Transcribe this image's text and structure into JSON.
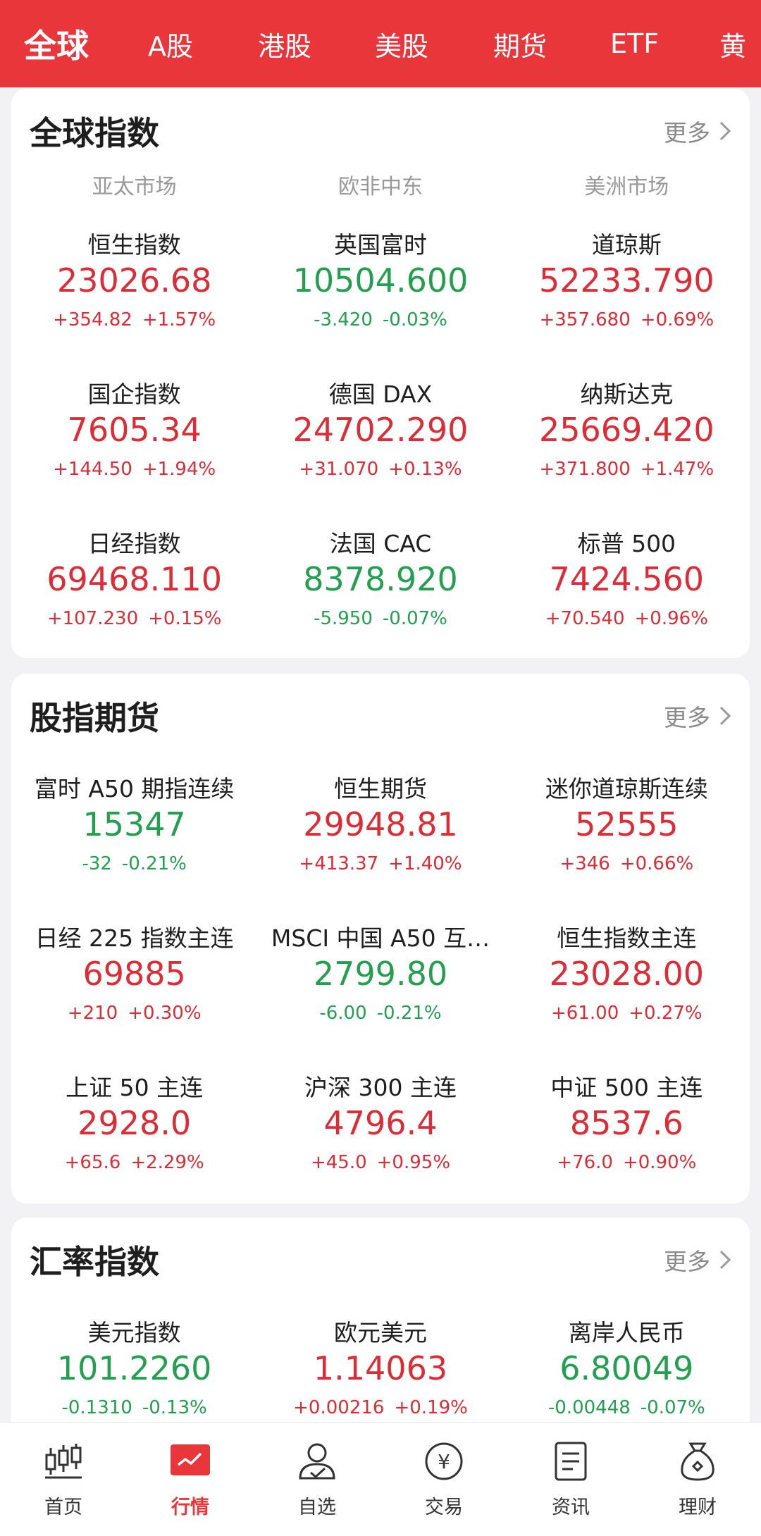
{
  "top_tabs": [
    {
      "label": "全球",
      "active": true
    },
    {
      "label": "A股"
    },
    {
      "label": "港股"
    },
    {
      "label": "美股"
    },
    {
      "label": "期货"
    },
    {
      "label": "ETF"
    },
    {
      "label": "黄"
    }
  ],
  "theme": {
    "brand_red": "#e8363b",
    "up_color": "#dd2c36",
    "down_color": "#22a04f"
  },
  "global_indices": {
    "title": "全球指数",
    "more_label": "更多",
    "regions": [
      "亚太市场",
      "欧非中东",
      "美洲市场"
    ],
    "items": [
      {
        "name": "恒生指数",
        "price": "23026.68",
        "change": "+354.82",
        "pct": "+1.57%",
        "dir": "up"
      },
      {
        "name": "英国富时",
        "price": "10504.600",
        "change": "-3.420",
        "pct": "-0.03%",
        "dir": "down"
      },
      {
        "name": "道琼斯",
        "price": "52233.790",
        "change": "+357.680",
        "pct": "+0.69%",
        "dir": "up"
      },
      {
        "name": "国企指数",
        "price": "7605.34",
        "change": "+144.50",
        "pct": "+1.94%",
        "dir": "up"
      },
      {
        "name": "德国 DAX",
        "price": "24702.290",
        "change": "+31.070",
        "pct": "+0.13%",
        "dir": "up"
      },
      {
        "name": "纳斯达克",
        "price": "25669.420",
        "change": "+371.800",
        "pct": "+1.47%",
        "dir": "up"
      },
      {
        "name": "日经指数",
        "price": "69468.110",
        "change": "+107.230",
        "pct": "+0.15%",
        "dir": "up"
      },
      {
        "name": "法国 CAC",
        "price": "8378.920",
        "change": "-5.950",
        "pct": "-0.07%",
        "dir": "down"
      },
      {
        "name": "标普 500",
        "price": "7424.560",
        "change": "+70.540",
        "pct": "+0.96%",
        "dir": "up"
      }
    ]
  },
  "index_futures": {
    "title": "股指期货",
    "more_label": "更多",
    "items": [
      {
        "name": "富时 A50 期指连续",
        "price": "15347",
        "change": "-32",
        "pct": "-0.21%",
        "dir": "down"
      },
      {
        "name": "恒生期货",
        "price": "29948.81",
        "change": "+413.37",
        "pct": "+1.40%",
        "dir": "up"
      },
      {
        "name": "迷你道琼斯连续",
        "price": "52555",
        "change": "+346",
        "pct": "+0.66%",
        "dir": "up"
      },
      {
        "name": "日经 225 指数主连",
        "price": "69885",
        "change": "+210",
        "pct": "+0.30%",
        "dir": "up"
      },
      {
        "name": "MSCI 中国 A50 互…",
        "price": "2799.80",
        "change": "-6.00",
        "pct": "-0.21%",
        "dir": "down"
      },
      {
        "name": "恒生指数主连",
        "price": "23028.00",
        "change": "+61.00",
        "pct": "+0.27%",
        "dir": "up"
      },
      {
        "name": "上证 50 主连",
        "price": "2928.0",
        "change": "+65.6",
        "pct": "+2.29%",
        "dir": "up"
      },
      {
        "name": "沪深 300 主连",
        "price": "4796.4",
        "change": "+45.0",
        "pct": "+0.95%",
        "dir": "up"
      },
      {
        "name": "中证 500 主连",
        "price": "8537.6",
        "change": "+76.0",
        "pct": "+0.90%",
        "dir": "up"
      }
    ]
  },
  "fx_indices": {
    "title": "汇率指数",
    "more_label": "更多",
    "items": [
      {
        "name": "美元指数",
        "price": "101.2260",
        "change": "-0.1310",
        "pct": "-0.13%",
        "dir": "down"
      },
      {
        "name": "欧元美元",
        "price": "1.14063",
        "change": "+0.00216",
        "pct": "+0.19%",
        "dir": "up"
      },
      {
        "name": "离岸人民币",
        "price": "6.80049",
        "change": "-0.00448",
        "pct": "-0.07%",
        "dir": "down"
      }
    ]
  },
  "bottom_nav": [
    {
      "label": "首页",
      "icon": "candlestick-icon"
    },
    {
      "label": "行情",
      "icon": "market-chart-icon",
      "active": true
    },
    {
      "label": "自选",
      "icon": "user-watchlist-icon"
    },
    {
      "label": "交易",
      "icon": "yuan-coin-icon"
    },
    {
      "label": "资讯",
      "icon": "news-document-icon"
    },
    {
      "label": "理财",
      "icon": "money-bag-icon"
    }
  ]
}
